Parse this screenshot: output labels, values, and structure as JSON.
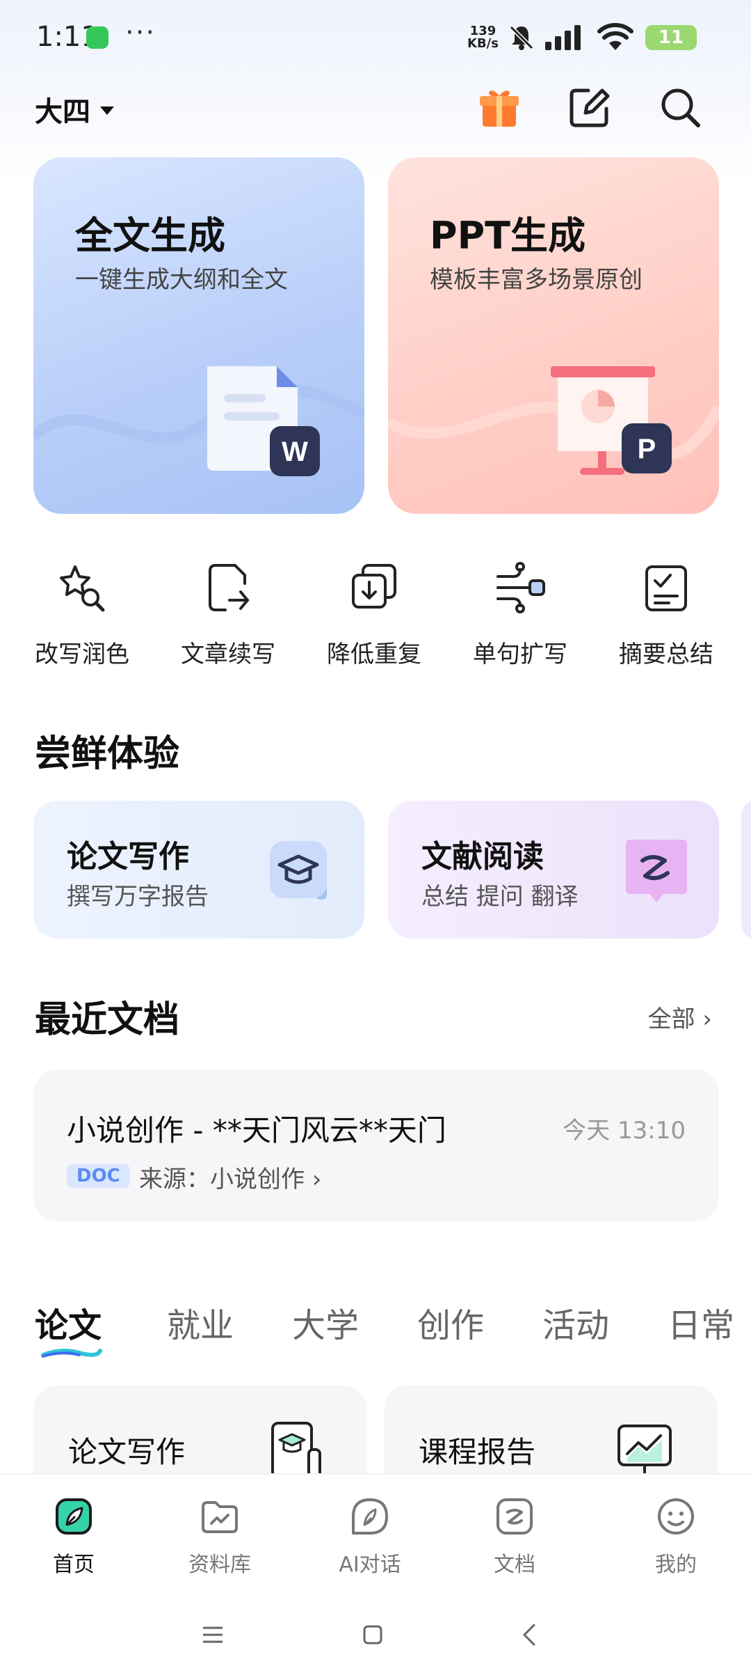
{
  "status_bar": {
    "time": "1:11",
    "more": "···",
    "net_speed_value": "139",
    "net_speed_unit": "KB/s",
    "battery": "11"
  },
  "header": {
    "grade": "大四"
  },
  "feature_cards": [
    {
      "title": "全文生成",
      "subtitle": "一键生成大纲和全文",
      "badge": "W"
    },
    {
      "title": "PPT生成",
      "subtitle": "模板丰富多场景原创",
      "badge": "P"
    }
  ],
  "tools": [
    {
      "label": "改写润色",
      "icon": "sparkle-search-icon"
    },
    {
      "label": "文章续写",
      "icon": "doc-continue-icon"
    },
    {
      "label": "降低重复",
      "icon": "dedupe-icon"
    },
    {
      "label": "单句扩写",
      "icon": "expand-icon"
    },
    {
      "label": "摘要总结",
      "icon": "summary-icon"
    }
  ],
  "try_section": {
    "title": "尝鲜体验",
    "cards": [
      {
        "title": "论文写作",
        "subtitle": "撰写万字报告",
        "icon": "graduation-cap-icon"
      },
      {
        "title": "文献阅读",
        "subtitle": "总结 提问 翻译",
        "icon": "reading-icon"
      }
    ]
  },
  "recent_section": {
    "title": "最近文档",
    "more": "全部 ›",
    "doc": {
      "name": "小说创作 - **天门风云**天门",
      "time": "今天 13:10",
      "type": "DOC",
      "source": "来源：小说创作 ›"
    }
  },
  "category_tabs": [
    "论文",
    "就业",
    "大学",
    "创作",
    "活动",
    "日常"
  ],
  "grid_cards": [
    {
      "title": "论文写作",
      "icon": "thesis-icon"
    },
    {
      "title": "课程报告",
      "icon": "presentation-chart-icon"
    }
  ],
  "bottom_nav": [
    {
      "label": "首页",
      "icon": "home-leaf-icon"
    },
    {
      "label": "资料库",
      "icon": "folder-icon"
    },
    {
      "label": "AI对话",
      "icon": "ai-chat-icon"
    },
    {
      "label": "文档",
      "icon": "document-icon"
    },
    {
      "label": "我的",
      "icon": "profile-face-icon"
    }
  ],
  "colors": {
    "accent": "#3e6bf0",
    "full_card": "#b9cff9",
    "ppt_card": "#ffcfc7",
    "gift": "#ff7a2e",
    "home_active": "#34d3a8"
  }
}
